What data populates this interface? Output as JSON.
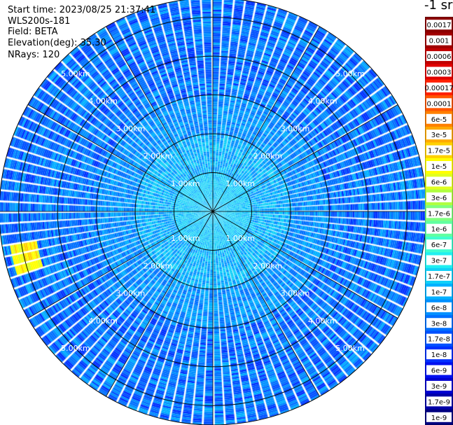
{
  "info": {
    "start_time": "Start time: 2023/08/25 21:37:41",
    "instrument": "WLS200s-181",
    "field": "Field: BETA",
    "elevation": "Elevation(deg): 35.30",
    "nrays": "NRays: 120"
  },
  "colorbar": {
    "title": "-1 sr",
    "labels": [
      "0.0017",
      "0.001",
      "0.0006",
      "0.0003",
      "0.00017",
      "0.0001",
      "6e-5",
      "3e-5",
      "1.7e-5",
      "1e-5",
      "6e-6",
      "3e-6",
      "1.7e-6",
      "1e-6",
      "6e-7",
      "3e-7",
      "1.7e-7",
      "1e-7",
      "6e-8",
      "3e-8",
      "1.7e-8",
      "1e-8",
      "6e-9",
      "3e-9",
      "1.7e-9",
      "1e-9"
    ],
    "colors": [
      "#8b0000",
      "#a00000",
      "#c00000",
      "#e00000",
      "#ff2000",
      "#ff5500",
      "#ff8000",
      "#ffaa00",
      "#ffd000",
      "#ffff00",
      "#e0ff20",
      "#b0ff40",
      "#80ff80",
      "#60ffa0",
      "#40ffd0",
      "#20f0f0",
      "#10d0f8",
      "#00b0ff",
      "#0090ff",
      "#0070ff",
      "#0050ff",
      "#0030ff",
      "#0010f0",
      "#0000d0",
      "#0000a8",
      "#000080"
    ]
  },
  "chart_data": {
    "type": "heatmap",
    "projection": "polar PPI scan",
    "n_rays": 120,
    "max_range_km": 5.5,
    "range_rings_km": [
      1.0,
      2.0,
      3.0,
      4.0,
      5.0
    ],
    "ring_labels": [
      "1.00km",
      "2.00km",
      "3.00km",
      "4.00km",
      "5.00km"
    ],
    "azimuth_spokes_deg": [
      0,
      30,
      60,
      90,
      120,
      150,
      180,
      210,
      240,
      270,
      300,
      330
    ],
    "grid": true,
    "value_distribution": [
      {
        "range_km": [
          0.0,
          1.0
        ],
        "typical_beta": "1.7e-7"
      },
      {
        "range_km": [
          1.0,
          2.0
        ],
        "typical_beta": "1e-7"
      },
      {
        "range_km": [
          2.0,
          3.0
        ],
        "typical_beta": "6e-8"
      },
      {
        "range_km": [
          3.0,
          5.5
        ],
        "typical_beta": "3e-8"
      }
    ],
    "hotspot": {
      "azimuth_deg": 255,
      "range_km": [
        4.6,
        5.3
      ],
      "beta": "1.7e-5"
    }
  }
}
